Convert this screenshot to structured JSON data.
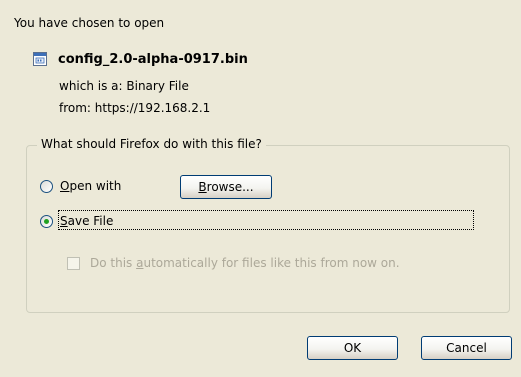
{
  "intro_text": "You have chosen to open",
  "file": {
    "name": "config_2.0-alpha-0917.bin",
    "which_is_a": "which is a:  Binary File",
    "from": "from:  https://192.168.2.1"
  },
  "group": {
    "legend": "What should Firefox do with this file?",
    "open_with": {
      "label_access": "O",
      "label_rest": "pen with",
      "checked": false
    },
    "browse_button": {
      "label_access": "B",
      "label_rest": "rowse..."
    },
    "save_file": {
      "label_access": "S",
      "label_rest": "ave File",
      "checked": true
    },
    "auto_checkbox": {
      "label_before": "Do this ",
      "label_access": "a",
      "label_after": "utomatically for files like this from now on.",
      "checked": false,
      "disabled": true
    }
  },
  "buttons": {
    "ok": "OK",
    "cancel": "Cancel"
  },
  "colors": {
    "dialog_background": "#ece9d8",
    "radio_dot": "#21a121",
    "disabled_text": "#aca899",
    "button_border": "#003c74"
  },
  "icons": {
    "file": "binary-file-icon"
  }
}
